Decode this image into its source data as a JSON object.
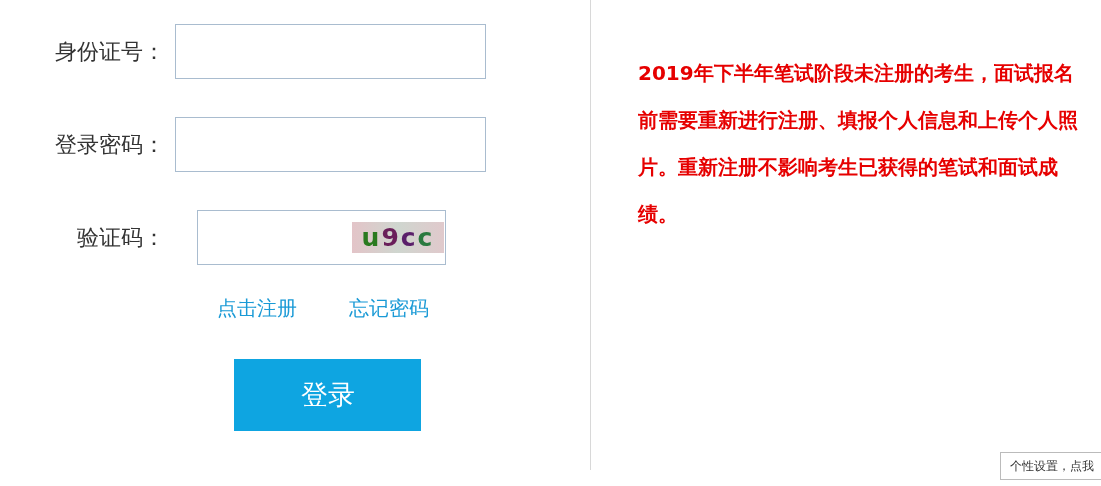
{
  "login_form": {
    "fields": [
      {
        "label": "身份证号：",
        "kind": "text"
      },
      {
        "label": "登录密码：",
        "kind": "password"
      },
      {
        "label": "验证码：",
        "kind": "captcha",
        "captcha": "u9cc"
      }
    ],
    "links": [
      "点击注册",
      "忘记密码"
    ],
    "submit": "登录"
  },
  "notice": "2019年下半年笔试阶段未注册的考生，面试报名前需要重新进行注册、填报个人信息和上传个人照片。重新注册不影响考生已获得的笔试和面试成绩。",
  "tooltip": "个性设置，点我"
}
